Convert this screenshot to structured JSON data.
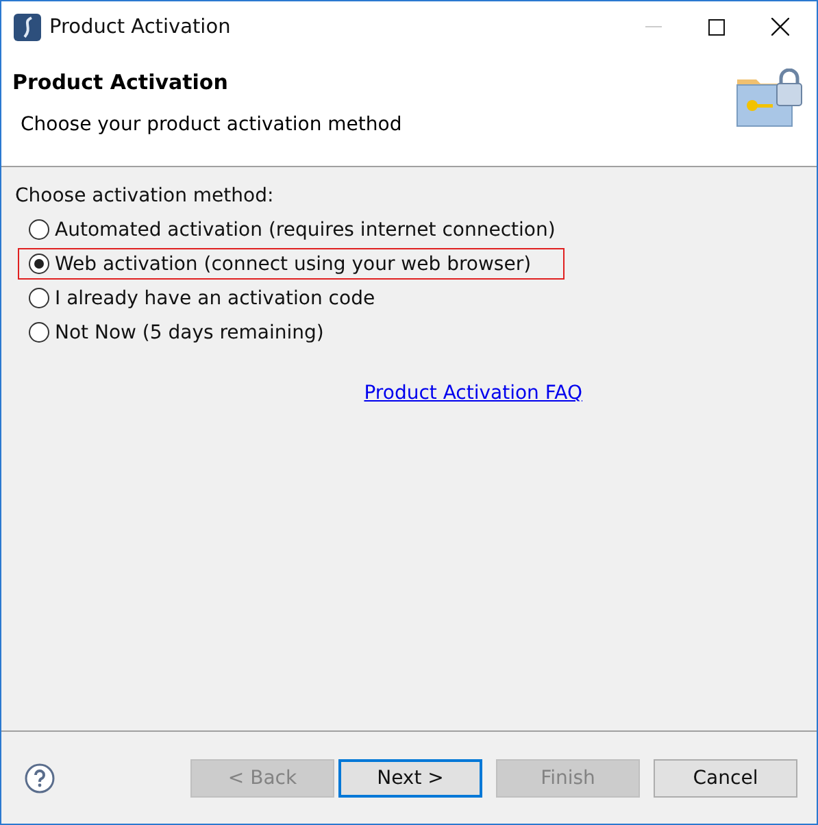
{
  "window": {
    "title": "Product Activation"
  },
  "header": {
    "title": "Product Activation",
    "subtitle": "Choose your product activation method"
  },
  "method": {
    "label": "Choose activation method:",
    "options": [
      {
        "label": "Automated activation (requires internet connection)",
        "selected": false,
        "highlighted": false
      },
      {
        "label": "Web activation (connect using your web browser)",
        "selected": true,
        "highlighted": true
      },
      {
        "label": "I already have an activation code",
        "selected": false,
        "highlighted": false
      },
      {
        "label": "Not Now (5 days remaining)",
        "selected": false,
        "highlighted": false
      }
    ]
  },
  "faq_link": "Product Activation FAQ",
  "buttons": [
    {
      "label": "< Back",
      "disabled": true,
      "default": false
    },
    {
      "label": "Next >",
      "disabled": false,
      "default": true
    },
    {
      "label": "Finish",
      "disabled": true,
      "default": false
    },
    {
      "label": "Cancel",
      "disabled": false,
      "default": false
    }
  ]
}
